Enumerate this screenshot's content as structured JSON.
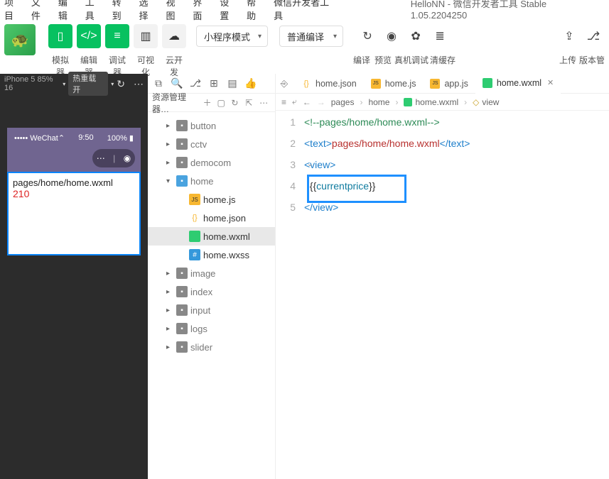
{
  "menubar": {
    "items": [
      "项目",
      "文件",
      "编辑",
      "工具",
      "转到",
      "选择",
      "视图",
      "界面",
      "设置",
      "帮助",
      "微信开发者工具"
    ],
    "title": "HelloNN - 微信开发者工具 Stable 1.05.2204250"
  },
  "toolbar": {
    "mode_select": "小程序模式",
    "compile_select": "普通编译",
    "labels": {
      "sim": "模拟器",
      "editor": "编辑器",
      "debug": "调试器",
      "vis": "可视化",
      "cloud": "云开发"
    },
    "right_labels": {
      "compile": "编译",
      "preview": "预览",
      "realdbg": "真机调试",
      "clear": "清缓存",
      "upload": "上传",
      "version": "版本管"
    }
  },
  "simulator": {
    "device": "iPhone 5 85% 16",
    "hot_reload": "热重载 开",
    "status_left": "••••• WeChat",
    "status_time": "9:50",
    "status_batt": "100%",
    "page_path": "pages/home/home.wxml",
    "page_value": "210"
  },
  "tree": {
    "title": "资源管理器…",
    "items": [
      {
        "label": "button",
        "type": "folder",
        "depth": 1,
        "expand": "▸"
      },
      {
        "label": "cctv",
        "type": "folder",
        "depth": 1,
        "expand": "▸"
      },
      {
        "label": "democom",
        "type": "folder",
        "depth": 1,
        "expand": "▸"
      },
      {
        "label": "home",
        "type": "folder-open",
        "depth": 1,
        "expand": "▾"
      },
      {
        "label": "home.js",
        "type": "js",
        "depth": 2
      },
      {
        "label": "home.json",
        "type": "json",
        "depth": 2
      },
      {
        "label": "home.wxml",
        "type": "wxml",
        "depth": 2,
        "selected": true
      },
      {
        "label": "home.wxss",
        "type": "wxss",
        "depth": 2
      },
      {
        "label": "image",
        "type": "folder",
        "depth": 1,
        "expand": "▸"
      },
      {
        "label": "index",
        "type": "folder",
        "depth": 1,
        "expand": "▸"
      },
      {
        "label": "input",
        "type": "folder",
        "depth": 1,
        "expand": "▸"
      },
      {
        "label": "logs",
        "type": "folder",
        "depth": 1,
        "expand": "▸"
      },
      {
        "label": "slider",
        "type": "folder",
        "depth": 1,
        "expand": "▸"
      }
    ]
  },
  "tabs": {
    "items": [
      {
        "label": "home.json",
        "type": "json"
      },
      {
        "label": "home.js",
        "type": "js"
      },
      {
        "label": "app.js",
        "type": "js"
      },
      {
        "label": "home.wxml",
        "type": "wxml",
        "active": true,
        "closable": true
      }
    ]
  },
  "breadcrumbs": {
    "items": [
      "pages",
      "home",
      "home.wxml",
      "view"
    ],
    "leaf_icon": "◇"
  },
  "code": {
    "lines": [
      {
        "num": "1",
        "html": "<span class='c-comment'>&lt;!--pages/home/home.wxml--&gt;</span>"
      },
      {
        "num": "2",
        "html": "<span class='c-tag'>&lt;text&gt;</span><span class='c-text'>pages/home/home.wxml</span><span class='c-tag'>&lt;/text&gt;</span>"
      },
      {
        "num": "3",
        "html": "<span class='c-tag'>&lt;view&gt;</span>",
        "fold": "⌄"
      },
      {
        "num": "4",
        "html": "  <span class='c-brace'>{</span><span class='c-brace'>{</span><span class='c-ident'>currentprice</span><span class='c-brace'>}</span><span class='c-brace'>}</span>",
        "highlighted": true
      },
      {
        "num": "5",
        "html": "<span class='c-tag'>&lt;/view&gt;</span>"
      }
    ]
  }
}
